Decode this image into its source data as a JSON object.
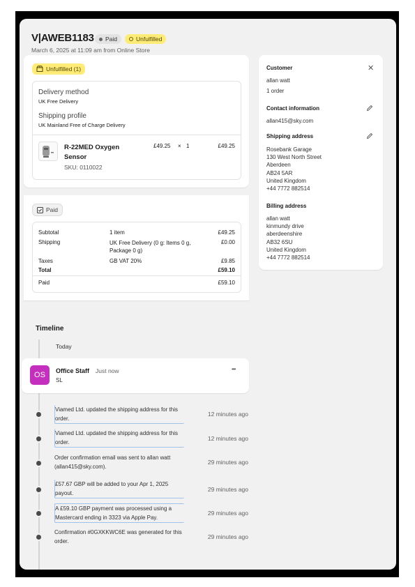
{
  "order": {
    "title": "V|AWEB1183",
    "paid_badge": "Paid",
    "unfulfilled_badge": "Unfulfilled",
    "subtitle": "March 6, 2025 at 11:09 am from Online Store"
  },
  "fulfillment": {
    "status_label": "Unfulfilled (1)",
    "delivery_method_label": "Delivery method",
    "delivery_method_value": "UK Free Delivery",
    "shipping_profile_label": "Shipping profile",
    "shipping_profile_value": "UK Mainland Free of Charge Delivery",
    "item": {
      "name_line1": "R-22MED Oxygen",
      "name_line2": "Sensor",
      "sku": "SKU: 0110022",
      "price": "£49.25",
      "times": "×",
      "qty": "1",
      "total": "£49.25"
    }
  },
  "payment": {
    "status_label": "Paid",
    "rows": [
      {
        "label": "Subtotal",
        "detail": "1 item",
        "amount": "£49.25"
      },
      {
        "label": "Shipping",
        "detail": "UK Free Delivery (0 g: Items 0 g,",
        "detail2": "Package 0 g)",
        "amount": "£0.00"
      },
      {
        "label": "Taxes",
        "detail": "GB VAT 20%",
        "amount": "£9.85"
      },
      {
        "label": "Total",
        "detail": "",
        "amount": "£59.10"
      },
      {
        "label": "Paid",
        "detail": "",
        "amount": "£59.10"
      }
    ]
  },
  "customer": {
    "heading": "Customer",
    "name": "allan watt",
    "orders": "1 order",
    "contact_heading": "Contact information",
    "email": "allan415@sky.com",
    "shipping_heading": "Shipping address",
    "shipping_lines": [
      "Rosebank Garage",
      "130 West North Street",
      "Aberdeen",
      "AB24 5AR",
      "United Kingdom",
      "+44 7772 882514"
    ],
    "billing_heading": "Billing address",
    "billing_lines": [
      "allan watt",
      "kinmundy drive",
      "aberdeenshire",
      "AB32 6SU",
      "United Kingdom",
      "+44 7772 882514"
    ]
  },
  "timeline": {
    "heading": "Timeline",
    "today": "Today",
    "comment": {
      "initials": "OS",
      "author": "Office Staff",
      "time": "Just now",
      "text": "SL",
      "more": "•••"
    },
    "events": [
      {
        "l1": "Viamed Ltd. updated the shipping address for this",
        "l2": "order.",
        "time": "12 minutes ago"
      },
      {
        "l1": "Viamed Ltd. updated the shipping address for this",
        "l2": "order.",
        "time": "12 minutes ago"
      },
      {
        "l1": "Order confirmation email was sent to allan watt",
        "l2": "(allan415@sky.com).",
        "time": "29 minutes ago"
      },
      {
        "l1": "£57.67 GBP will be added to your Apr 1, 2025",
        "l2": "payout.",
        "time": "29 minutes ago"
      },
      {
        "l1": "A £59.10 GBP payment was processed using a",
        "l2": "Mastercard ending in 3323 via Apple Pay.",
        "time": "29 minutes ago"
      },
      {
        "l1": "Confirmation #0GXKKWC6E was generated for this",
        "l2": "order.",
        "time": "29 minutes ago"
      }
    ]
  },
  "colors": {
    "avatar": "#c42fbd",
    "unfulfilled": "#ffeb78",
    "timeline_box": "#9fc2e8"
  }
}
